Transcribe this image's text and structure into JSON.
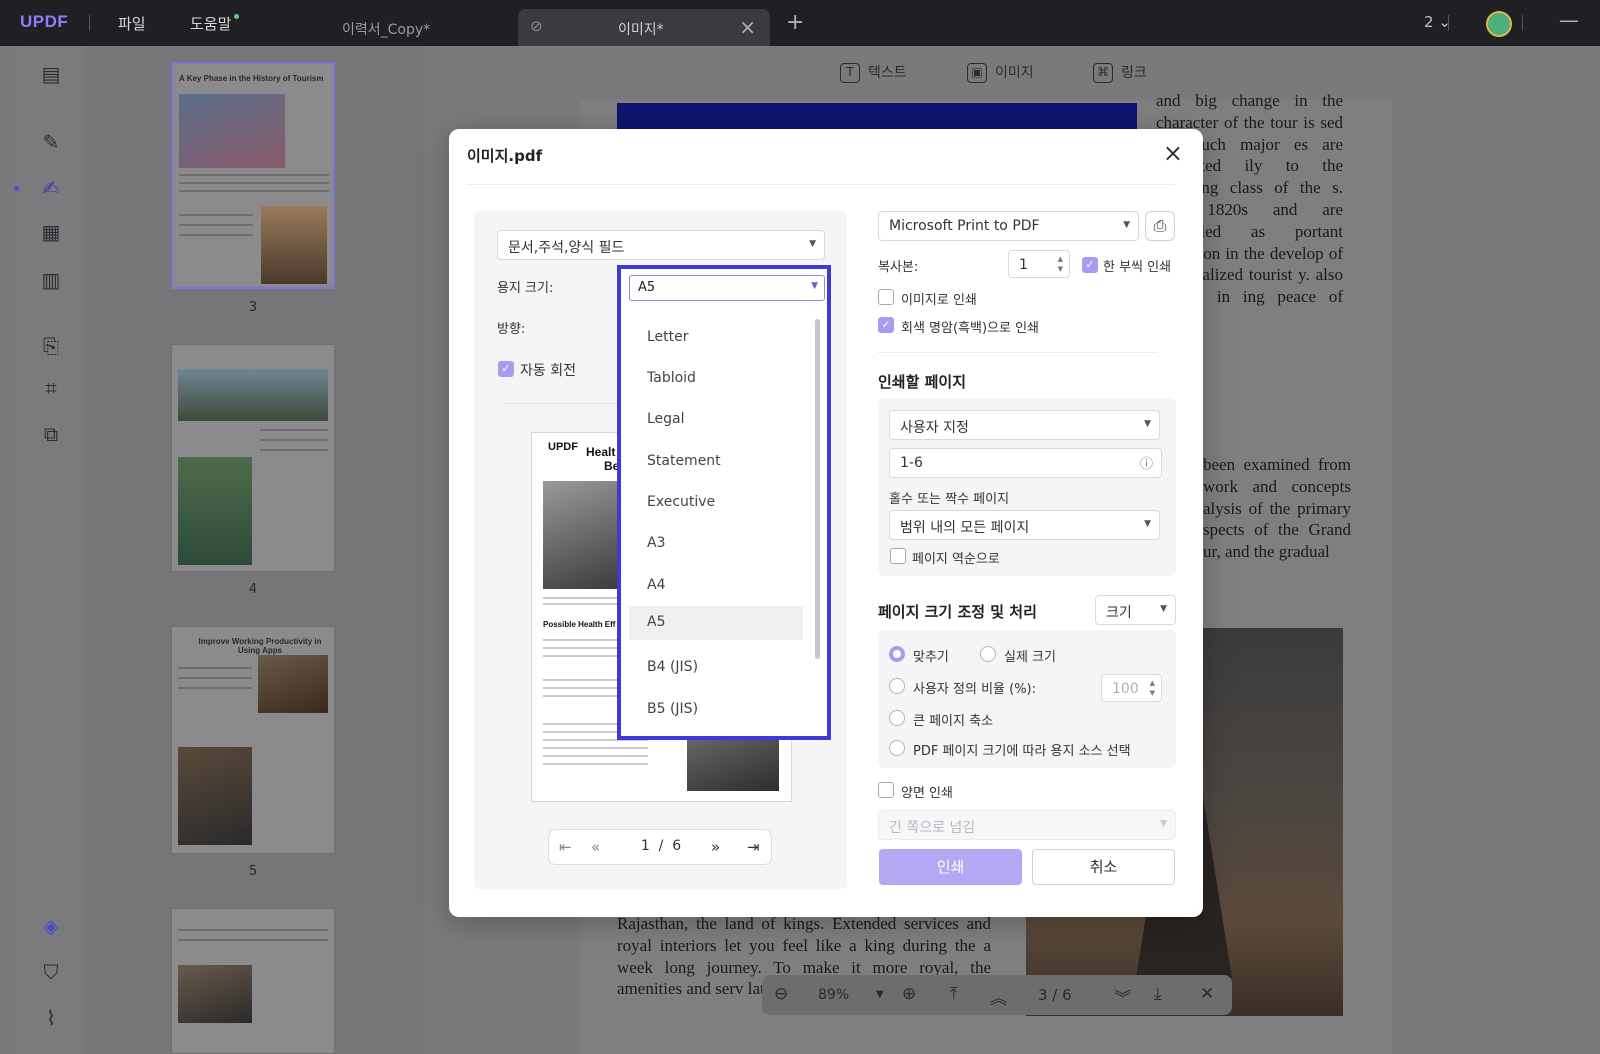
{
  "app": {
    "logo": "UPDF",
    "menu_file": "파일",
    "menu_help": "도움말",
    "page_count": "2"
  },
  "tabs": [
    {
      "label": "이력서_Copy*"
    },
    {
      "label": "이미지*"
    }
  ],
  "edit_toolbar": {
    "text": "텍스트",
    "image": "이미지",
    "link": "링크"
  },
  "thumbnails": [
    {
      "number": "3",
      "title": "A Key Phase in the History of Tourism"
    },
    {
      "number": "4",
      "title": ""
    },
    {
      "number": "5",
      "title": "Improve Working Productivity in Using Apps"
    },
    {
      "number": "",
      "title": ""
    }
  ],
  "document": {
    "right_col_top": "and big change in the character of the tour is sed and such major es are attributed ily to the changing class of the s. The 1820s and are identified as portant transition in the develop of a formalized tourist y. also helpful in ing peace of mind.",
    "right_col_mid": "been examined from work and concepts alysis of the primary spects of the Grand ur, and the gradual",
    "bottom_left": "Rajasthan, the land of kings. Extended services and royal interiors let you feel like a king during the a week long journey. To make it more royal, the amenities and serv latest trends and requ"
  },
  "bottom_nav": {
    "zoom": "89%",
    "page": "3 / 6"
  },
  "dialog": {
    "title": "이미지.pdf",
    "content_select": "문서,주석,양식 필드",
    "paper_size_label": "용지 크기:",
    "paper_size_value": "A5",
    "orientation_label": "방향:",
    "auto_rotate_label": "자동 회전",
    "paper_options": [
      "Letter",
      "Tabloid",
      "Legal",
      "Statement",
      "Executive",
      "A3",
      "A4",
      "A5",
      "B4 (JIS)",
      "B5 (JIS)"
    ],
    "preview": {
      "logo": "UPDF",
      "title_a": "Healt",
      "title_b": "Be",
      "heading": "Possible Health Eff"
    },
    "pager": {
      "current": "1",
      "separator": "/",
      "total": "6"
    },
    "printer": "Microsoft Print to PDF",
    "copies_label": "복사본:",
    "copies_value": "1",
    "collate_label": "한 부씩 인쇄",
    "print_as_image_label": "이미지로 인쇄",
    "grayscale_label": "회색 명암(흑백)으로 인쇄",
    "pages_section_title": "인쇄할 페이지",
    "pages_mode": "사용자 지정",
    "pages_range": "1-6",
    "odd_even_label": "홀수 또는 짝수 페이지",
    "odd_even_value": "범위 내의 모든 페이지",
    "reverse_label": "페이지 역순으로",
    "scaling_section_title": "페이지 크기 조정 및 처리",
    "scaling_select": "크기",
    "fit_label": "맞추기",
    "actual_size_label": "실제 크기",
    "custom_scale_label": "사용자 정의 비율 (%):",
    "custom_scale_value": "100",
    "shrink_label": "큰 페이지 축소",
    "paper_source_label": "PDF 페이지 크기에 따라 용지 소스 선택",
    "duplex_label": "양면 인쇄",
    "flip_value": "긴 쪽으로 넘김",
    "print_button": "인쇄",
    "cancel_button": "취소"
  },
  "colors": {
    "accent": "#a89cf2",
    "highlight_border": "#3d3ad8",
    "topbar": "#1f2024"
  }
}
